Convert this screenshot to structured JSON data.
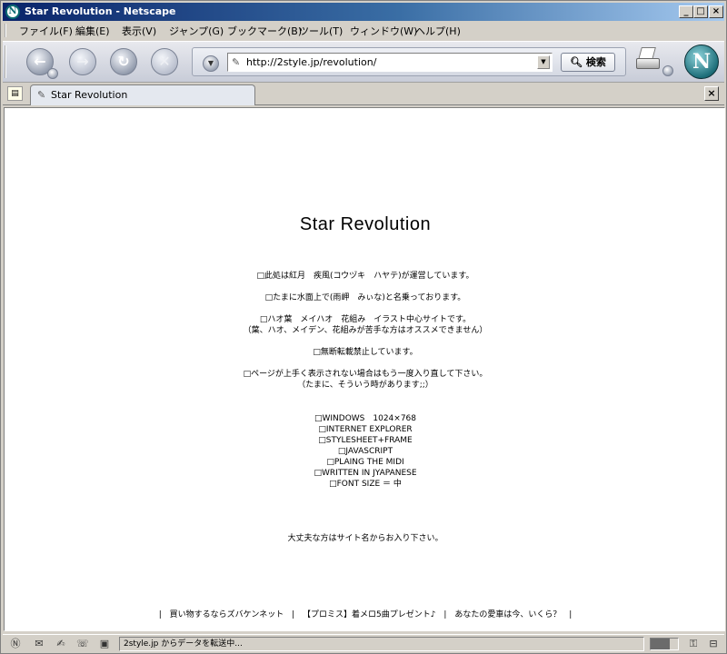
{
  "window": {
    "title": "Star Revolution - Netscape"
  },
  "menu": [
    "ファイル(F)",
    "編集(E)",
    "表示(V)",
    "ジャンプ(G)",
    "ブックマーク(B)",
    "ツール(T)",
    "ウィンドウ(W)",
    "ヘルプ(H)"
  ],
  "toolbar": {
    "url": "http://2style.jp/revolution/",
    "search_label": "検索"
  },
  "tab": {
    "label": "Star Revolution"
  },
  "page": {
    "title": "Star Revolution",
    "notes": [
      "□此処は紅月　疾風(コウヅキ　ハヤテ)が運営しています。",
      "□たまに水面上で(雨岬　みぃな)と名乗っております。",
      "□ハオ葉　メイハオ　花組み　イラスト中心サイトです。",
      "（葉、ハオ、メイデン、花組みが苦手な方はオススメできません）",
      "□無断転載禁止しています。",
      "□ページが上手く表示されない場合はもう一度入り直して下さい。",
      "（たまに、そういう時があります;;）"
    ],
    "requirements": [
      "□WINDOWS　1024×768",
      "□INTERNET EXPLORER",
      "□STYLESHEET+FRAME",
      "□JAVASCRIPT",
      "□PLAING THE MIDI",
      "□WRITTEN IN JYAPANESE",
      "□FONT SIZE ＝ 中"
    ],
    "enter_text": "大丈夫な方はサイト名からお入り下さい。",
    "footer_links": [
      "買い物するならズバケンネット",
      "【プロミス】着メロ5曲プレゼント♪",
      "あなたの愛車は今、いくら？"
    ]
  },
  "status": {
    "text": "2style.jp からデータを転送中...",
    "progress": 0.7
  },
  "icons": {
    "app": "netscape-icon",
    "back": "back-arrow-icon",
    "forward": "forward-arrow-icon",
    "reload": "reload-icon",
    "stop": "stop-icon",
    "print": "print-icon",
    "logo": "netscape-logo-icon"
  }
}
